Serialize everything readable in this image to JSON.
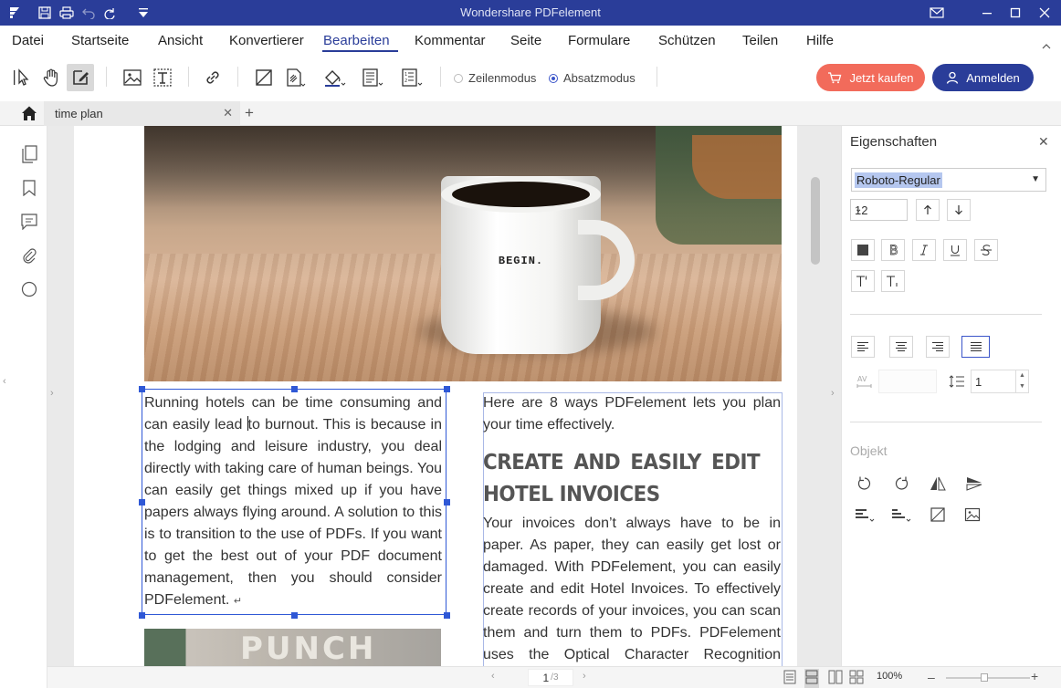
{
  "window": {
    "title": "Wondershare PDFelement"
  },
  "menu": [
    "Datei",
    "Startseite",
    "Ansicht",
    "Konvertierer",
    "Bearbeiten",
    "Kommentar",
    "Seite",
    "Formulare",
    "Schützen",
    "Teilen",
    "Hilfe"
  ],
  "toolbar": {
    "line_mode": "Zeilenmodus",
    "paragraph_mode": "Absatzmodus",
    "buy_label": "Jetzt kaufen",
    "login_label": "Anmelden"
  },
  "tabs": [
    {
      "label": "time plan"
    }
  ],
  "document": {
    "mug_text": "BEGIN.",
    "left_paragraph_a": "Running hotels can be time consuming and can easily lead ",
    "left_paragraph_b": "to burnout. This is because in the lodging and leisure industry, you deal directly with taking care of human beings. You can easily get things mixed up if you have papers always flying around. A solution to this is to transition to the use of PDFs. If you want to get the best out of your PDF document management, then you should consider PDFelement.",
    "return_mark": "↵",
    "right_intro": "Here are 8 ways PDFelement lets you plan your time effectively.",
    "heading": "CREATE AND EASILY EDIT HOTEL INVOICES",
    "right_paragraph": "Your invoices don’t always have to be in paper. As paper, they can easily get lost or damaged. With PDFelement, you can easily create and edit Hotel Invoices. To effectively create records of your invoices, you can scan them and turn them to PDFs. PDFelement uses the Optical Character Recognition (OCR)",
    "image2_text": "PUNCH"
  },
  "statusbar": {
    "page_current": "1",
    "page_total": "/3",
    "zoom": "100%"
  },
  "properties": {
    "title": "Eigenschaften",
    "font": "Roboto-Regular",
    "font_size": "12",
    "line_spacing": "1",
    "object_label": "Objekt"
  },
  "colors": {
    "title_bar": "#2a3d99",
    "buy_button": "#f26b5b",
    "login_button": "#2a3d99",
    "selection": "#2f58d6"
  }
}
